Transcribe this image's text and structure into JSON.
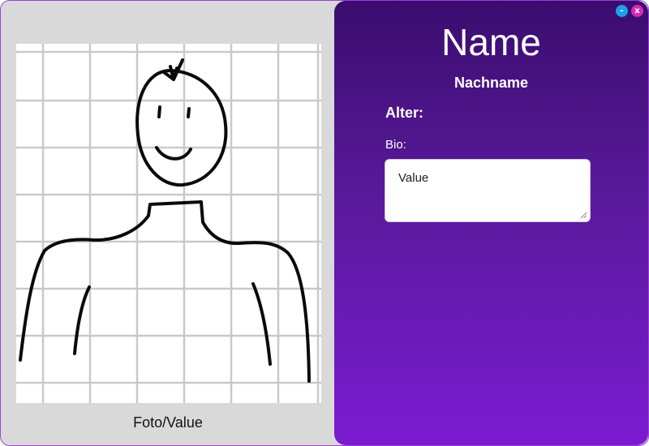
{
  "window": {
    "minimize_label": "-",
    "close_label": "x"
  },
  "left_panel": {
    "photo_caption": "Foto/Value"
  },
  "right_panel": {
    "title": "Name",
    "subtitle": "Nachname",
    "age_label": "Alter:",
    "bio_label": "Bio:",
    "bio_value": "Value"
  },
  "colors": {
    "panel_gradient_top": "#3a0d6e",
    "panel_gradient_bottom": "#7b1bd2",
    "minimize_button": "#1da1e8",
    "close_button": "#d629b8",
    "left_background": "#d9d9d9"
  }
}
